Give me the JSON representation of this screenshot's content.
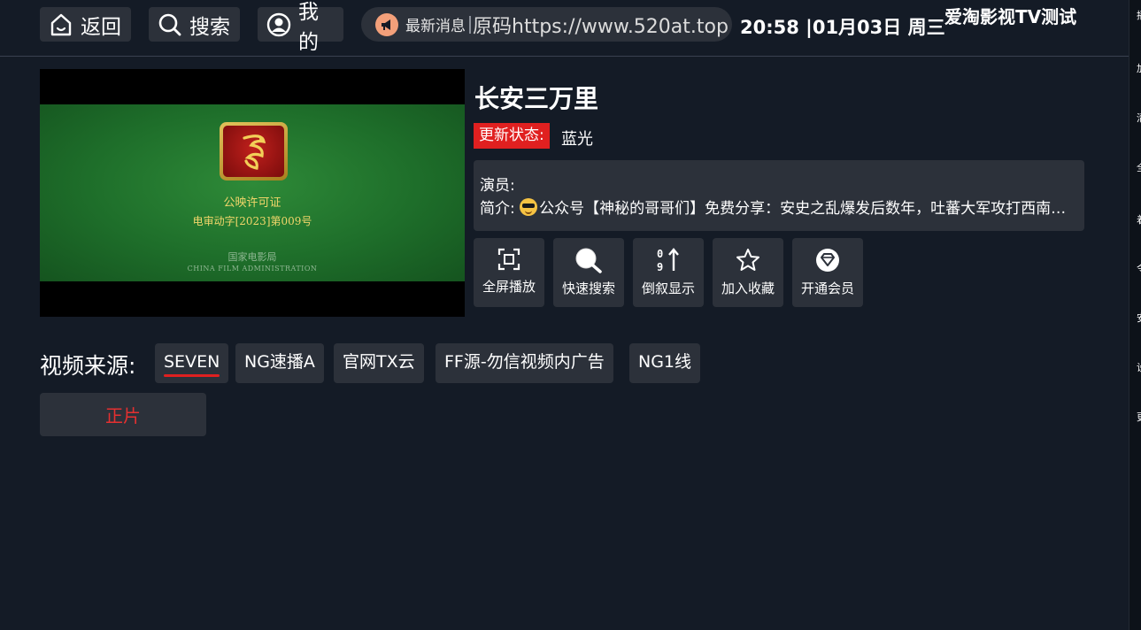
{
  "nav": {
    "back_label": "返回",
    "search_label": "搜索",
    "mine_label": "我的"
  },
  "news": {
    "label": "最新消息",
    "text": "原码https://www.520at.top"
  },
  "clock": "20:58 |01月03日 周三",
  "app_title": "爱淘影视TV测试",
  "right_strip": [
    "播",
    "加",
    "清",
    "全",
    "着",
    "令",
    "安",
    "设",
    "更"
  ],
  "poster": {
    "line1": "公映许可证",
    "line2": "电审动字[2023]第009号",
    "line3": "国家电影局",
    "line4": "CHINA FILM ADMINISTRATION"
  },
  "movie": {
    "title": "长安三万里",
    "status_label": "更新状态:",
    "status_value": "蓝光",
    "actors_label": "演员:",
    "actors_value": "",
    "intro_label": "简介:",
    "intro_text": "公众号【神秘的哥哥们】免费分享：安史之乱爆发后数年，吐蕃大军攻打西南…"
  },
  "actions": [
    {
      "label": "全屏播放",
      "icon": "fullscreen-icon"
    },
    {
      "label": "快速搜索",
      "icon": "search-icon"
    },
    {
      "label": "倒叙显示",
      "icon": "sort-icon"
    },
    {
      "label": "加入收藏",
      "icon": "star-icon"
    },
    {
      "label": "开通会员",
      "icon": "diamond-icon"
    }
  ],
  "sources": {
    "label": "视频来源:",
    "items": [
      "SEVEN",
      "NG速播A",
      "官网TX云",
      "FF源-勿信视频内广告",
      "NG1线"
    ],
    "selected": "SEVEN"
  },
  "episodes": [
    "正片"
  ],
  "colors": {
    "background": "#141b26",
    "panel": "#2c313a",
    "accent_red": "#e02020",
    "news_icon": "#f3a07a"
  }
}
